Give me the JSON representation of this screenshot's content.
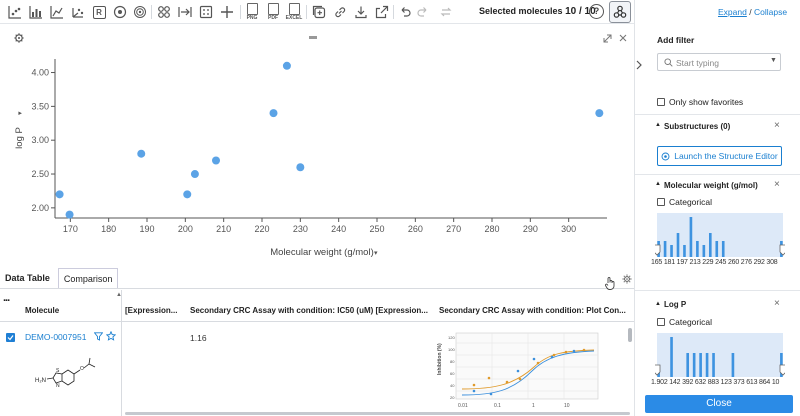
{
  "toolbar": {
    "selected_label": "Selected molecules",
    "selected_count": "10 / 10",
    "help_label": "?",
    "r_label": "R",
    "png_label": "PNG",
    "pdf_label": "PDF",
    "excel_label": "EXCEL"
  },
  "chart_data": {
    "type": "scatter",
    "xlabel": "Molecular weight (g/mol)",
    "ylabel": "log P",
    "xlim": [
      166,
      310
    ],
    "ylim": [
      1.85,
      4.2
    ],
    "x_ticks": [
      170,
      180,
      190,
      200,
      210,
      220,
      230,
      240,
      250,
      260,
      270,
      280,
      290,
      300
    ],
    "y_ticks": [
      2.0,
      2.5,
      3.0,
      3.5,
      4.0
    ],
    "y_tick_labels": [
      "2.00",
      "2.50",
      "3.00",
      "3.50",
      "4.00"
    ],
    "grid": false,
    "point_color": "#5ba3e6",
    "points": [
      {
        "x": 167.2,
        "y": 2.2
      },
      {
        "x": 169.8,
        "y": 1.9
      },
      {
        "x": 188.5,
        "y": 2.8
      },
      {
        "x": 200.5,
        "y": 2.2
      },
      {
        "x": 202.5,
        "y": 2.5
      },
      {
        "x": 208.0,
        "y": 2.7
      },
      {
        "x": 223.0,
        "y": 3.4
      },
      {
        "x": 226.5,
        "y": 4.1
      },
      {
        "x": 230.0,
        "y": 2.6
      },
      {
        "x": 308.0,
        "y": 3.4
      }
    ]
  },
  "table": {
    "tabs": [
      {
        "label": "Data Table",
        "active": true
      },
      {
        "label": "Comparison",
        "active": false
      }
    ],
    "more_label": "...",
    "columns": [
      {
        "label": "Molecule"
      },
      {
        "label": "[Expression..."
      },
      {
        "label": "Secondary CRC Assay with condition: IC50 (uM) [Expression..."
      },
      {
        "label": "Secondary CRC Assay with condition: Plot Con..."
      }
    ],
    "rows": [
      {
        "id": "DEMO-0007951",
        "ic50": "1.16"
      }
    ],
    "mini_plot": {
      "ylabel": "Inhibition (%)",
      "x_tick_labels": [
        "0.01",
        "0.1",
        "1",
        "10"
      ]
    }
  },
  "panel": {
    "expand_label": "Expand",
    "divider": "/",
    "collapse_label": "Collapse",
    "add_filter_title": "Add filter",
    "search_placeholder": "Start typing",
    "show_favorites_label": "Only show favorites",
    "substructures_title": "Substructures (0)",
    "launch_label": "Launch the Structure Editor",
    "mw_title": "Molecular weight (g/mol)",
    "categorical_label": "Categorical",
    "mw_axis": "165 181 197 213 229 245 260 276 292 308",
    "mw_bins": [
      0.4,
      0,
      0.4,
      0,
      0.3,
      0,
      0.6,
      0,
      0.3,
      0,
      1.0,
      0,
      0.4,
      0,
      0.3,
      0,
      0.6,
      0,
      0.4,
      0,
      0.4,
      0,
      0,
      0,
      0,
      0,
      0,
      0,
      0,
      0,
      0,
      0,
      0,
      0,
      0,
      0,
      0,
      0,
      0.4
    ],
    "logp_title": "Log P",
    "logp_axis": "1.902 142 392 632 883 123 373 613 864 10",
    "logp_bins": [
      0.3,
      0,
      0,
      0,
      1.0,
      0,
      0,
      0,
      0,
      0.6,
      0,
      0.6,
      0,
      0.6,
      0,
      0.6,
      0,
      0.6,
      0,
      0,
      0,
      0,
      0,
      0.6,
      0,
      0,
      0,
      0,
      0,
      0,
      0,
      0,
      0,
      0,
      0,
      0,
      0,
      0,
      0.6
    ],
    "close_label": "Close"
  }
}
